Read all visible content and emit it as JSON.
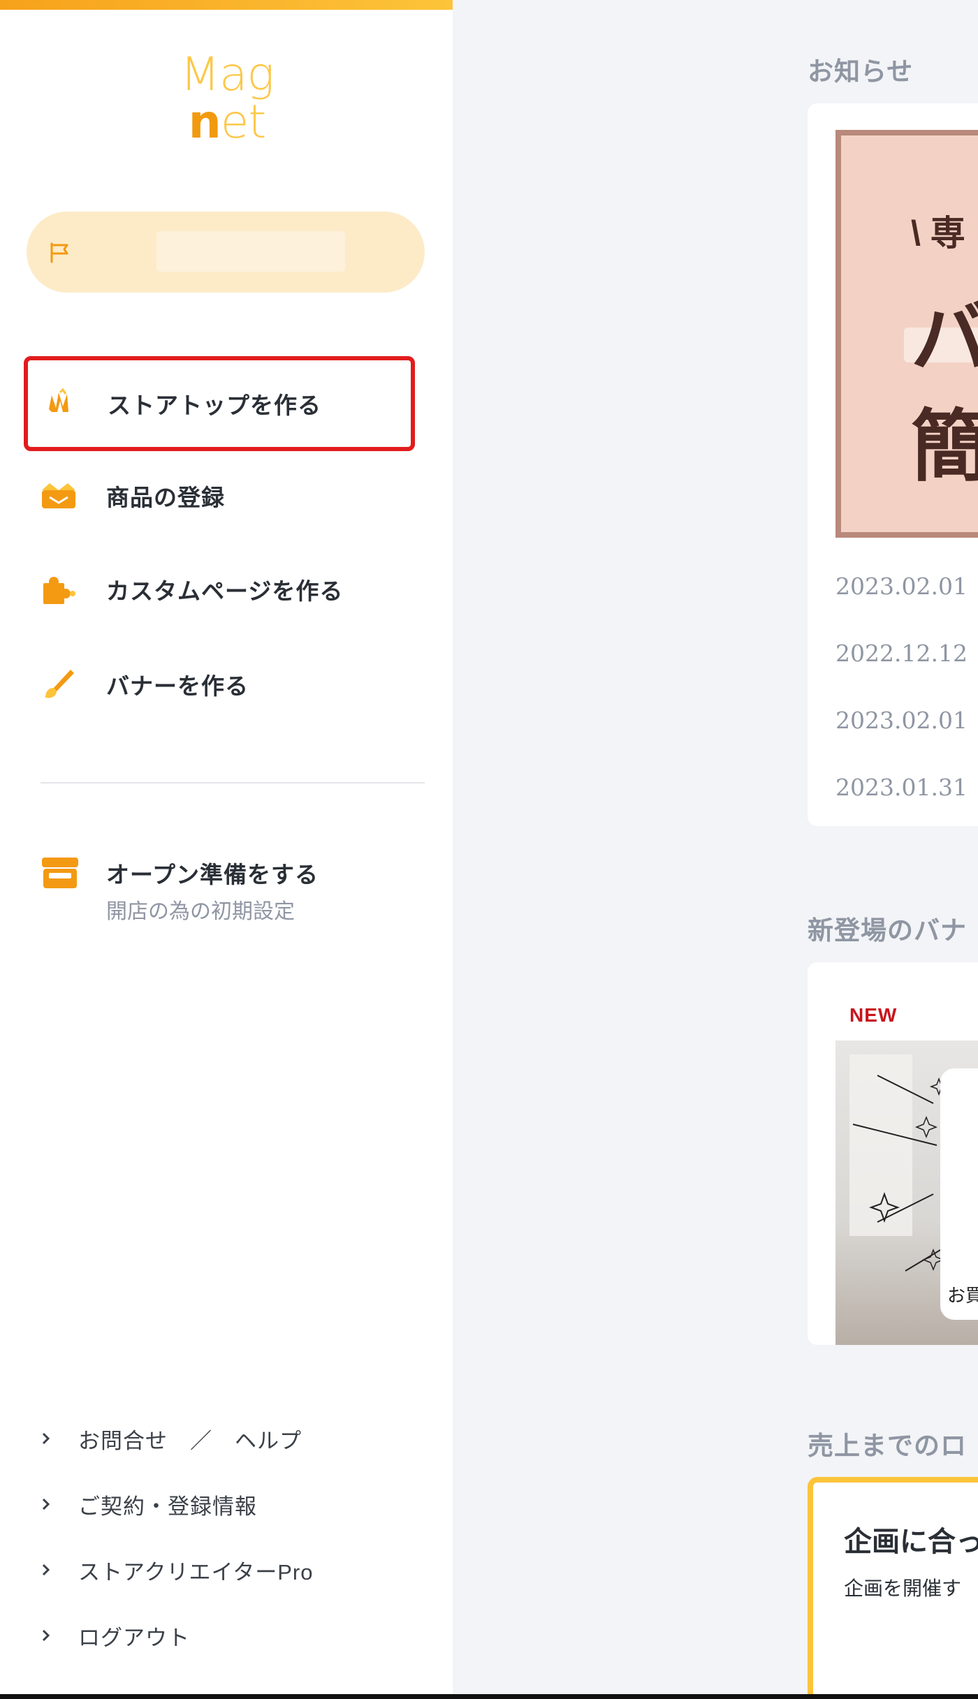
{
  "logo": {
    "line1": "Mag",
    "line2_first": "n",
    "line2_rest": "et"
  },
  "store": {
    "name": ""
  },
  "nav": [
    {
      "label": "ストアトップを作る",
      "icon": "store-top-icon",
      "highlighted": true
    },
    {
      "label": "商品の登録",
      "icon": "product-box-icon",
      "highlighted": false
    },
    {
      "label": "カスタムページを作る",
      "icon": "puzzle-icon",
      "highlighted": false
    },
    {
      "label": "バナーを作る",
      "icon": "paint-brush-icon",
      "highlighted": false
    }
  ],
  "open_prep": {
    "label": "オープン準備をする",
    "sub": "開店の為の初期設定",
    "icon": "shop-icon"
  },
  "footer_links": [
    {
      "label": "お問合せ　／　ヘルプ"
    },
    {
      "label": "ご契約・登録情報"
    },
    {
      "label": "ストアクリエイターPro"
    },
    {
      "label": "ログアウト"
    }
  ],
  "main": {
    "news": {
      "title": "お知らせ",
      "banner": {
        "line1": "\\ 専",
        "line2": "バ",
        "line3": "簡"
      },
      "dates": [
        "2023.02.01",
        "2022.12.12",
        "2023.02.01",
        "2023.01.31"
      ]
    },
    "new_banners": {
      "title": "新登場のバナ",
      "badge": "NEW",
      "thumb_text": "お買"
    },
    "flow": {
      "title": "売上までのロ",
      "heading": "企画に合っ",
      "text": "企画を開催す"
    }
  },
  "colors": {
    "accent": "#fcc43a",
    "icon_orange": "#f39a12",
    "highlight_red": "#e21c1c",
    "pill_bg": "#fdebc8"
  }
}
